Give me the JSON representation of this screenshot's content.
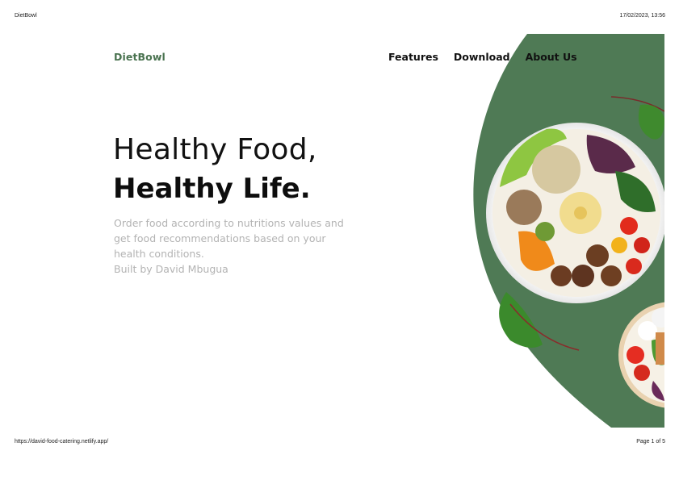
{
  "print_header": {
    "title": "DietBowl",
    "datetime": "17/02/2023, 13:56"
  },
  "print_footer": {
    "url": "https://david-food-catering.netlify.app/",
    "page": "Page 1 of 5"
  },
  "header": {
    "brand": "DietBowl",
    "nav": [
      {
        "label": "Features"
      },
      {
        "label": "Download"
      },
      {
        "label": "About Us"
      }
    ]
  },
  "hero": {
    "title_line1": "Healthy Food,",
    "title_line2": "Healthy Life.",
    "description": "Order food according to nutritions values and get food recommendations based on your health conditions.",
    "credit": "Built by David Mbugua"
  },
  "colors": {
    "brand": "#4a7350",
    "blob": "#4f7a55",
    "muted_text": "#b3b3b3"
  }
}
